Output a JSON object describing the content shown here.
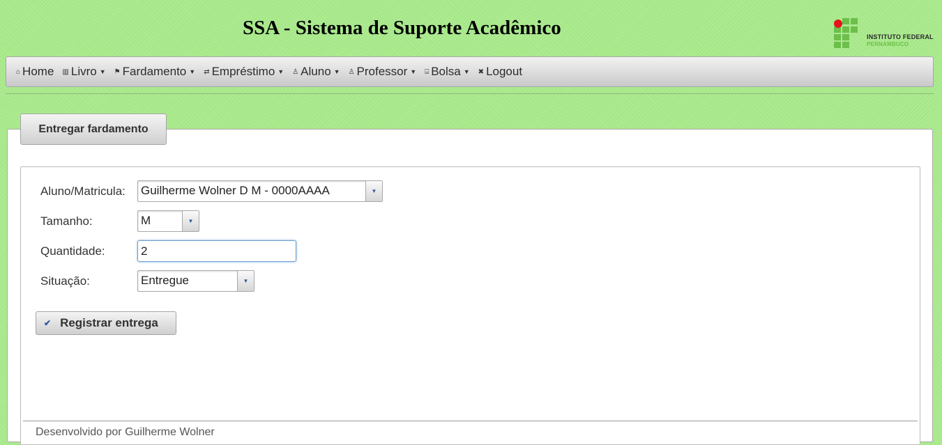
{
  "header": {
    "title": "SSA - Sistema de Suporte Acadêmico"
  },
  "logo": {
    "line1": "INSTITUTO FEDERAL",
    "line2": "PERNAMBUCO",
    "accent": "#6cbf4a",
    "dot": "#e3141b"
  },
  "nav": {
    "items": [
      {
        "label": "Home",
        "icon": "home-icon",
        "dropdown": false
      },
      {
        "label": "Livro",
        "icon": "book-icon",
        "dropdown": true
      },
      {
        "label": "Fardamento",
        "icon": "flag-icon",
        "dropdown": true
      },
      {
        "label": "Empréstimo",
        "icon": "transfer-icon",
        "dropdown": true
      },
      {
        "label": "Aluno",
        "icon": "user-icon",
        "dropdown": true
      },
      {
        "label": "Professor",
        "icon": "user-icon",
        "dropdown": true
      },
      {
        "label": "Bolsa",
        "icon": "lock-icon",
        "dropdown": true
      },
      {
        "label": "Logout",
        "icon": "close-icon",
        "dropdown": false
      }
    ]
  },
  "panel": {
    "tab_label": "Entregar fardamento"
  },
  "form": {
    "aluno": {
      "label": "Aluno/Matricula:",
      "value": "Guilherme Wolner D M - 0000AAAA"
    },
    "tamanho": {
      "label": "Tamanho:",
      "value": "M"
    },
    "quantidade": {
      "label": "Quantidade:",
      "value": "2"
    },
    "situacao": {
      "label": "Situação:",
      "value": "Entregue"
    },
    "submit_label": "Registrar entrega"
  },
  "footer": {
    "text": "Desenvolvido por Guilherme Wolner"
  },
  "colors": {
    "background": "#a9ea8b",
    "link_accent": "#2a5c9c"
  }
}
